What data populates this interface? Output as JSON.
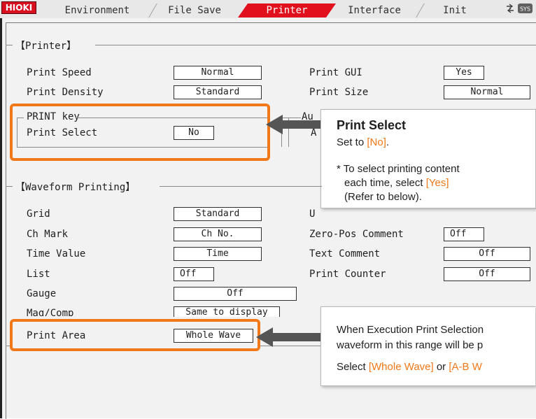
{
  "brand": "HIOKI",
  "tabs": [
    {
      "label": "Environment"
    },
    {
      "label": "File Save"
    },
    {
      "label": "Printer",
      "active": true
    },
    {
      "label": "Interface"
    },
    {
      "label": "Init"
    }
  ],
  "sys_icon": "SYS",
  "printer": {
    "title": "【Printer】",
    "print_speed": {
      "label": "Print Speed",
      "value": "Normal"
    },
    "print_density": {
      "label": "Print Density",
      "value": "Standard"
    },
    "print_gui": {
      "label": "Print GUI",
      "value": "Yes"
    },
    "print_size": {
      "label": "Print Size",
      "value": "Normal"
    },
    "print_key": {
      "title": "PRINT key",
      "label": "Print Select",
      "value": "No"
    },
    "auto_group": {
      "title": "Au",
      "label": "A"
    }
  },
  "waveform": {
    "title": "【Waveform Printing】",
    "grid": {
      "label": "Grid",
      "value": "Standard"
    },
    "ch_mark": {
      "label": "Ch Mark",
      "value": "Ch No."
    },
    "time_value": {
      "label": "Time Value",
      "value": "Time"
    },
    "list": {
      "label": "List",
      "value": "Off"
    },
    "gauge": {
      "label": "Gauge",
      "value": "Off"
    },
    "mag_comp": {
      "label": "Mag/Comp",
      "value": "Same to display"
    },
    "print_area": {
      "label": "Print Area",
      "value": "Whole Wave"
    },
    "upper_label": "U",
    "zero_pos_comment": {
      "label": "Zero-Pos Comment",
      "value": "Off"
    },
    "text_comment": {
      "label": "Text Comment",
      "value": "Off"
    },
    "print_counter": {
      "label": "Print Counter",
      "value": "Off"
    }
  },
  "callout_print_select": {
    "title": "Print Select",
    "line1_prefix": "Set to ",
    "line1_value": "[No]",
    "line1_suffix": ".",
    "note_prefix": "* To select printing content",
    "note_line2_prefix": "each time, select ",
    "note_value": "[Yes]",
    "note_line3": "(Refer to below)."
  },
  "callout_print_area": {
    "line1": "When Execution Print Selection",
    "line2": "waveform in this range will be p",
    "line3_prefix": "Select ",
    "opt1": "[Whole Wave]",
    "line3_mid": " or ",
    "opt2": "[A-B W"
  },
  "colors": {
    "accent": "#f07818",
    "tab_active": "#e0101c",
    "brand": "#d81020",
    "arrow": "#555555"
  }
}
